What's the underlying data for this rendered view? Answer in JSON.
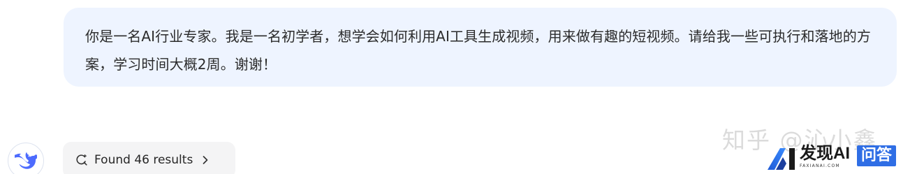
{
  "conversation": {
    "user_message": "你是一名AI行业专家。我是一名初学者，想学会如何利用AI工具生成视频，用来做有趣的短视频。请给我一些可执行和落地的方案，学习时间大概2周。谢谢！",
    "search_status": {
      "label": "Found 46 results",
      "icon": "search-icon",
      "expand_icon": "chevron-right-icon"
    },
    "assistant_avatar_icon": "whale-logo-icon"
  },
  "watermarks": {
    "zhihu": "知乎 @沁小鑫",
    "faxian_logo": {
      "brand": "发现AI",
      "domain": "FAXIANAI.COM",
      "badge": "问答"
    }
  },
  "colors": {
    "bubble_background": "#eef4ff",
    "pill_background": "#f4f4f5",
    "avatar_accent": "#4d6bfe",
    "badge_blue": "#2f6ee5"
  }
}
